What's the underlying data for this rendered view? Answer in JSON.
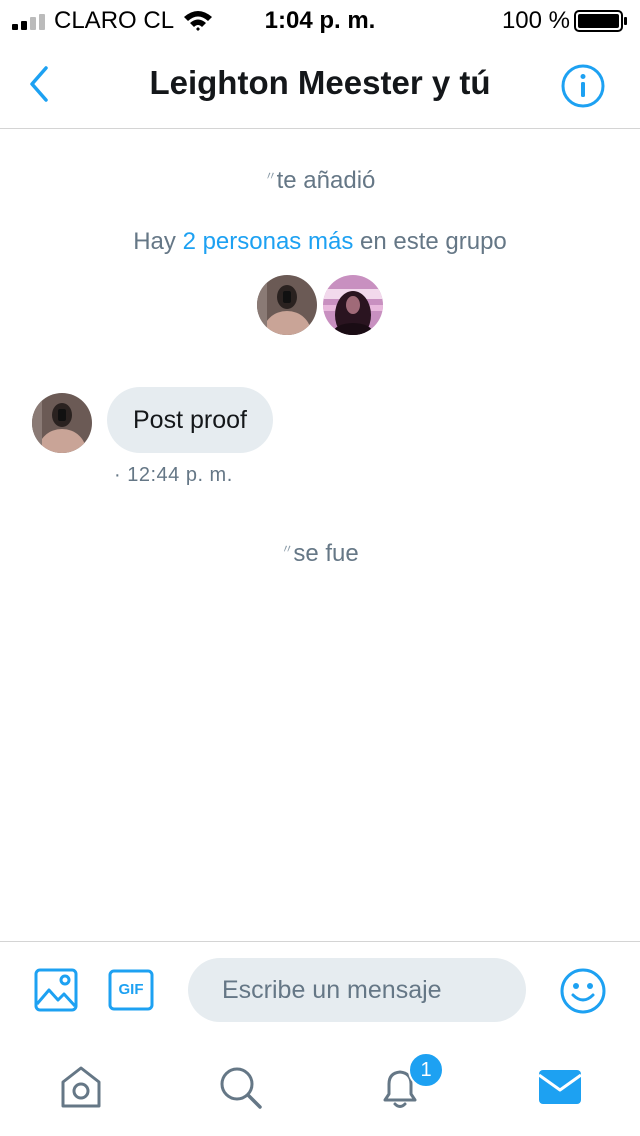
{
  "status_bar": {
    "carrier": "CLARO CL",
    "time": "1:04 p. m.",
    "battery_percent": "100 %"
  },
  "header": {
    "title": "Leighton Meester y tú"
  },
  "conversation": {
    "added_notice": "te añadió",
    "participants": {
      "prefix": "Hay",
      "link": "2 personas más",
      "suffix": "en este grupo"
    },
    "message": {
      "text": "Post proof",
      "time": "· 12:44 p. m."
    },
    "left_notice": "se fue"
  },
  "composer": {
    "placeholder": "Escribe un mensaje",
    "gif_label": "GIF"
  },
  "tabbar": {
    "notifications_badge": "1"
  },
  "colors": {
    "accent": "#1da1f2",
    "secondary_text": "#657786",
    "bubble": "#e6ecf0"
  }
}
